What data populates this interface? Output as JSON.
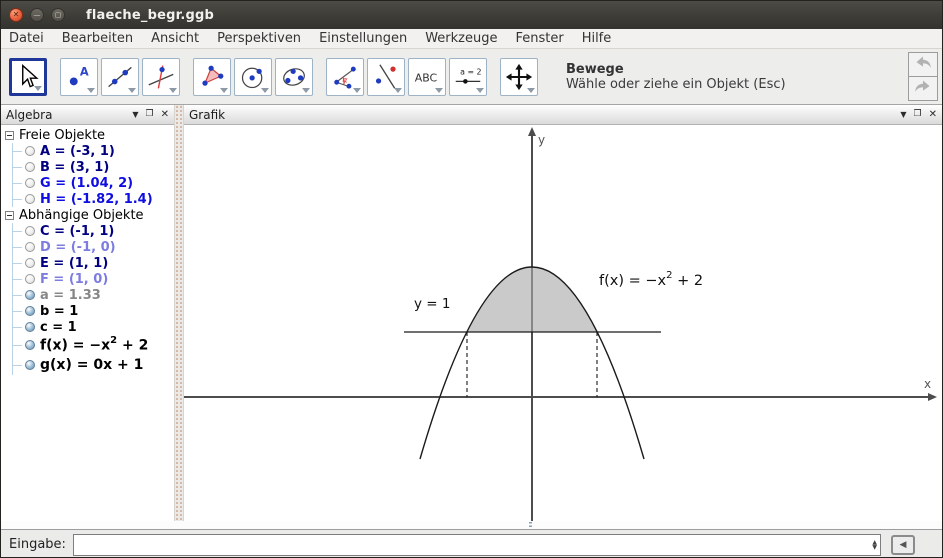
{
  "window": {
    "title": "flaeche_begr.ggb"
  },
  "icons": {
    "close": "✕",
    "minimize": "—",
    "maximize": "▢",
    "panel_dropdown": "▼",
    "panel_undock": "❐",
    "panel_close": "✕",
    "input_history_toggle": "◀",
    "spinner_up": "▲",
    "spinner_down": "▼"
  },
  "menu": {
    "items": [
      "Datei",
      "Bearbeiten",
      "Ansicht",
      "Perspektiven",
      "Einstellungen",
      "Werkzeuge",
      "Fenster",
      "Hilfe"
    ]
  },
  "toolbar": {
    "tools": [
      "move",
      "point",
      "line",
      "perpendicular-line",
      "polygon",
      "circle-with-center",
      "conic-through-points",
      "angle",
      "mirror",
      "insert-text",
      "slider",
      "move-graphics-view"
    ],
    "icon_labels": {
      "point": "A",
      "angle": "α",
      "text": "ABC",
      "slider": "a = 2"
    },
    "status_title": "Bewege",
    "status_subtitle": "Wähle oder ziehe ein Objekt (Esc)"
  },
  "algebra": {
    "title": "Algebra",
    "free_group_label": "Freie Objekte",
    "dependent_group_label": "Abhängige Objekte",
    "free_items": [
      {
        "text": "A = (-3, 1)"
      },
      {
        "text": "B = (3, 1)"
      },
      {
        "text": "G = (1.04, 2)"
      },
      {
        "text": "H = (-1.82, 1.4)"
      }
    ],
    "dependent_items": [
      {
        "text": "C = (-1, 1)"
      },
      {
        "text": "D = (-1, 0)"
      },
      {
        "text": "E = (1, 1)"
      },
      {
        "text": "F = (1, 0)"
      },
      {
        "text": "a = 1.33"
      },
      {
        "text": "b = 1"
      },
      {
        "text": "c = 1"
      }
    ],
    "f_item": {
      "pre": "f(x) = −x",
      "sup": "2",
      "post": " + 2"
    },
    "g_item": {
      "text": "g(x) = 0x + 1"
    }
  },
  "graph": {
    "title": "Grafik",
    "x_axis_label": "x",
    "y_axis_label": "y",
    "line_label": "y = 1",
    "f_label": {
      "pre": "f(x) = −x",
      "sup": "2",
      "post": " + 2"
    }
  },
  "input_bar": {
    "label": "Eingabe:",
    "value": ""
  },
  "colors": {
    "selected_tool_border": "#1f3799",
    "object_dark_blue": "#000080",
    "object_bright_blue": "#0e0ee0",
    "object_light_blue": "#7d7de0",
    "object_gray": "#878787",
    "region_fill": "#c9c9c9",
    "titlebar_close": "#e85f3c"
  }
}
